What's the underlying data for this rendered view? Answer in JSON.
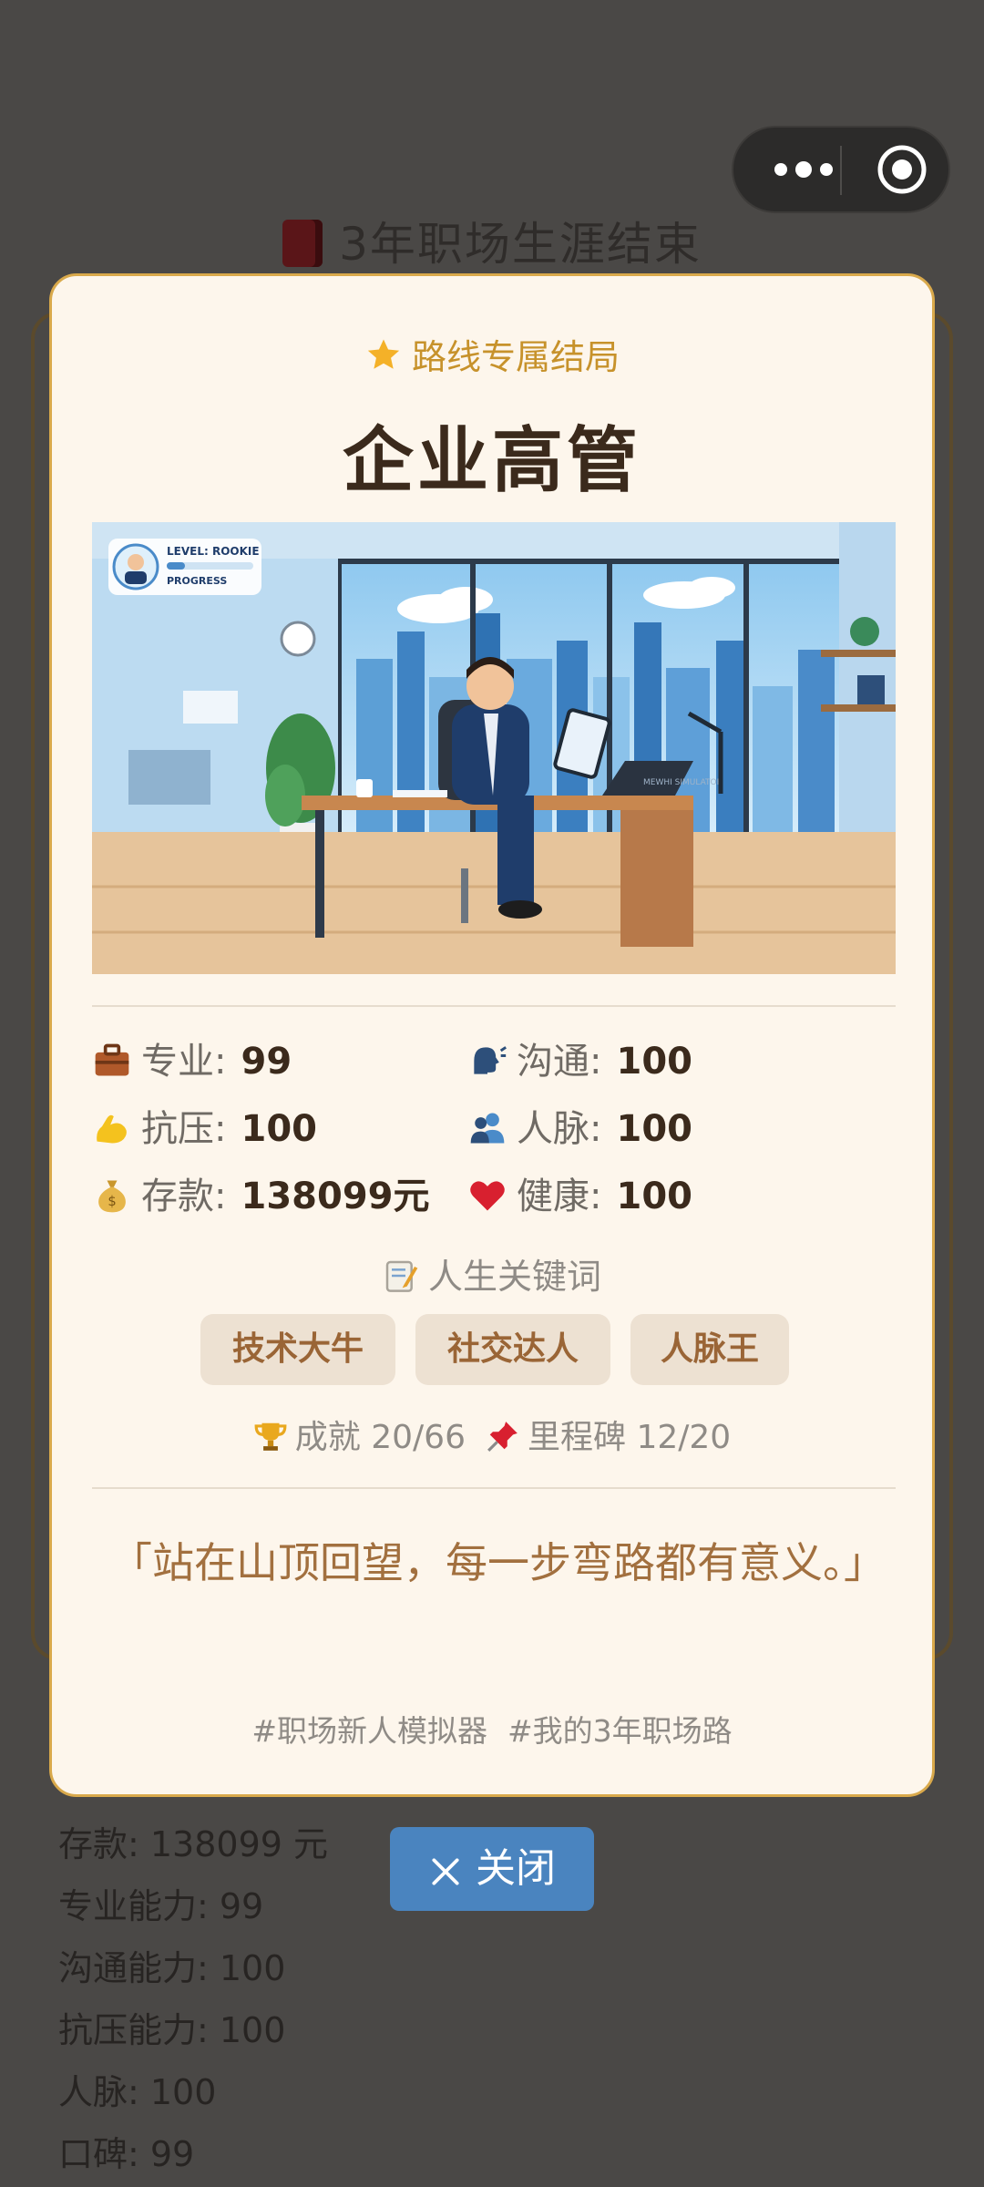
{
  "background": {
    "title": "3年职场生涯结束",
    "stats": [
      "存款: 138099 元",
      "专业能力: 99",
      "沟通能力: 100",
      "抗压能力: 100",
      "人脉: 100",
      "口碑: 99"
    ]
  },
  "modal": {
    "route_tag": "路线专属结局",
    "ending_title": "企业高管",
    "illustration": {
      "badge_level": "LEVEL: ROOKIE",
      "badge_progress": "PROGRESS",
      "laptop_text": "MEWHI SIMULATOR"
    },
    "stats": [
      {
        "icon": "briefcase-icon",
        "label": "专业:",
        "value": "99"
      },
      {
        "icon": "speaking-head-icon",
        "label": "沟通:",
        "value": "100"
      },
      {
        "icon": "flexed-biceps-icon",
        "label": "抗压:",
        "value": "100"
      },
      {
        "icon": "people-icon",
        "label": "人脉:",
        "value": "100"
      },
      {
        "icon": "money-bag-icon",
        "label": "存款:",
        "value": "138099元"
      },
      {
        "icon": "heart-icon",
        "label": "健康:",
        "value": "100"
      }
    ],
    "keywords_heading": "人生关键词",
    "keywords": [
      "技术大牛",
      "社交达人",
      "人脉王"
    ],
    "achievements": "成就 20/66",
    "milestones": "里程碑 12/20",
    "quote": "「站在山顶回望，每一步弯路都有意义。」",
    "hashtags": [
      "#职场新人模拟器",
      "#我的3年职场路"
    ],
    "close_label": "关闭"
  },
  "colors": {
    "card_bg": "#fdf6ec",
    "card_border": "#d9a94b",
    "accent_gold": "#c7922b",
    "chip_bg": "#ede1d2",
    "chip_text": "#9a6536",
    "close_button": "#4a84bf"
  }
}
